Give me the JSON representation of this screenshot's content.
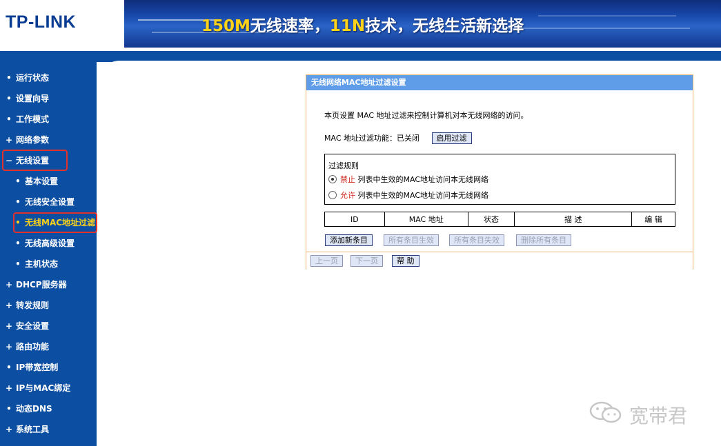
{
  "header": {
    "logo": "TP-LINK",
    "banner_prefix_hl": "150M",
    "banner_mid": "无线速率，",
    "banner_hl2": "11N",
    "banner_suffix": "技术，无线生活新选择"
  },
  "sidebar": {
    "items": [
      {
        "marker": "•",
        "label": "运行状态"
      },
      {
        "marker": "•",
        "label": "设置向导"
      },
      {
        "marker": "•",
        "label": "工作模式"
      },
      {
        "marker": "+",
        "label": "网络参数"
      },
      {
        "marker": "−",
        "label": "无线设置"
      },
      {
        "marker": "•",
        "label": "基本设置"
      },
      {
        "marker": "•",
        "label": "无线安全设置"
      },
      {
        "marker": "•",
        "label": "无线MAC地址过滤"
      },
      {
        "marker": "•",
        "label": "无线高级设置"
      },
      {
        "marker": "•",
        "label": "主机状态"
      },
      {
        "marker": "+",
        "label": "DHCP服务器"
      },
      {
        "marker": "+",
        "label": "转发规则"
      },
      {
        "marker": "+",
        "label": "安全设置"
      },
      {
        "marker": "+",
        "label": "路由功能"
      },
      {
        "marker": "•",
        "label": "IP带宽控制"
      },
      {
        "marker": "+",
        "label": "IP与MAC绑定"
      },
      {
        "marker": "•",
        "label": "动态DNS"
      },
      {
        "marker": "+",
        "label": "系统工具"
      }
    ]
  },
  "panel": {
    "title": "无线网络MAC地址过滤设置",
    "description": "本页设置 MAC 地址过滤来控制计算机对本无线网络的访问。",
    "filter_label": "MAC 地址过滤功能：",
    "filter_status": "已关闭",
    "enable_button": "启用过滤",
    "rules_title": "过滤规则",
    "rule_deny_keyword": "禁止",
    "rule_deny_text": "列表中生效的MAC地址访问本无线网络",
    "rule_allow_keyword": "允许",
    "rule_allow_text": "列表中生效的MAC地址访问本无线网络",
    "table_headers": [
      "ID",
      "MAC 地址",
      "状态",
      "描 述",
      "编 辑"
    ],
    "add_button": "添加新条目",
    "enable_all_button": "所有条目生效",
    "disable_all_button": "所有条目失效",
    "delete_all_button": "删除所有条目",
    "prev_button": "上一页",
    "next_button": "下一页",
    "help_button": "帮 助"
  },
  "watermark": {
    "text": "宽带君"
  },
  "colors": {
    "sidebar_bg": "#0b4ea2",
    "highlight_text": "#ffd21a",
    "panel_title_bg": "#5f9de8",
    "panel_border": "#f1b86b",
    "annotation_red": "#e3312b"
  }
}
